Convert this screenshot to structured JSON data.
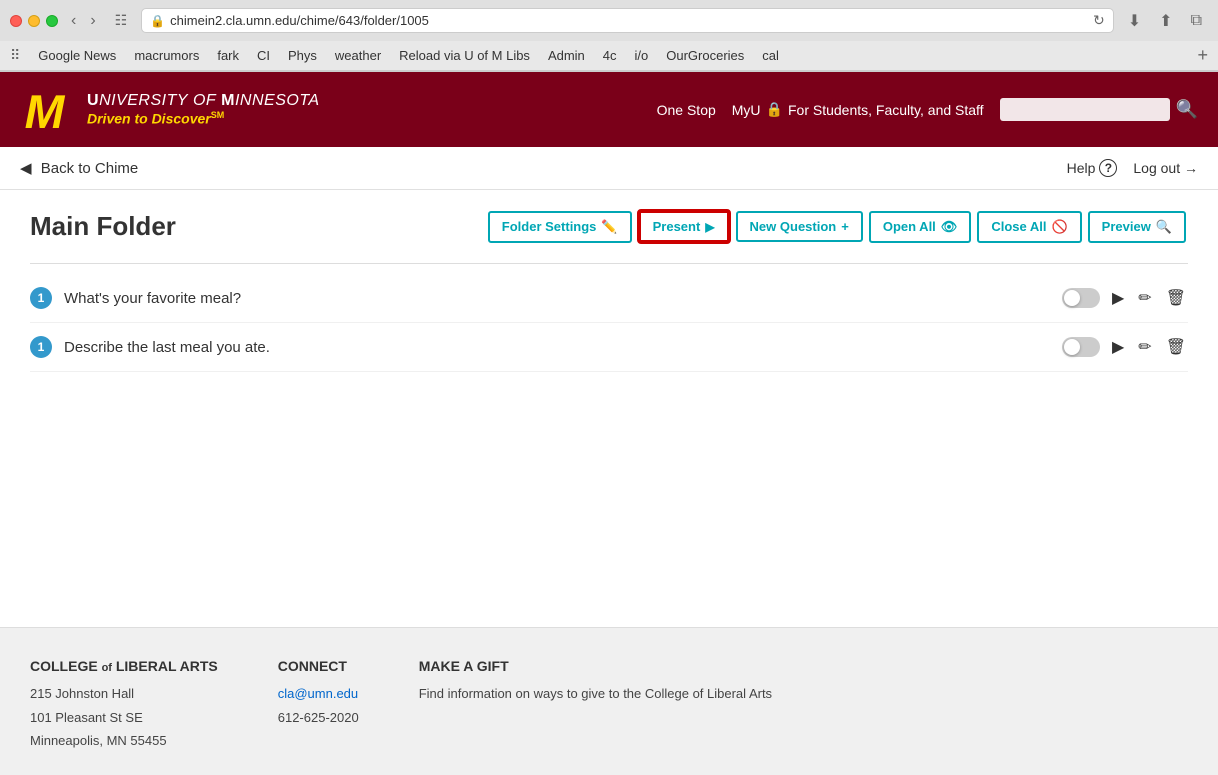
{
  "browser": {
    "url": "chimein2.cla.umn.edu/chime/643/folder/1005",
    "bookmarks": [
      "Google News",
      "macrumors",
      "fark",
      "CI",
      "Phys",
      "weather",
      "Reload via U of M Libs",
      "Admin",
      "4c",
      "i/o",
      "OurGroceries",
      "cal"
    ]
  },
  "header": {
    "university_name": "University of Minnesota",
    "tagline": "Driven to Discover",
    "one_stop": "One Stop",
    "myu": "MyU",
    "myu_desc": "For Students, Faculty, and Staff",
    "search_placeholder": ""
  },
  "page": {
    "back_link": "Back to Chime",
    "help_label": "Help",
    "logout_label": "Log out",
    "folder_title": "Main Folder",
    "actions": {
      "folder_settings": "Folder Settings",
      "present": "Present",
      "new_question": "New Question",
      "open_all": "Open All",
      "close_all": "Close All",
      "preview": "Preview"
    },
    "questions": [
      {
        "id": 1,
        "text": "What's your favorite meal?",
        "badge": "1"
      },
      {
        "id": 2,
        "text": "Describe the last meal you ate.",
        "badge": "1"
      }
    ]
  },
  "footer": {
    "college": {
      "name": "College",
      "of": "of",
      "arts": "Liberal Arts",
      "address1": "215 Johnston Hall",
      "address2": "101 Pleasant St SE",
      "address3": "Minneapolis, MN 55455"
    },
    "connect": {
      "label": "Connect",
      "email": "cla@umn.edu",
      "phone": "612-625-2020"
    },
    "gift": {
      "label": "Make a Gift",
      "desc": "Find information on ways to give to the College of Liberal Arts"
    }
  }
}
